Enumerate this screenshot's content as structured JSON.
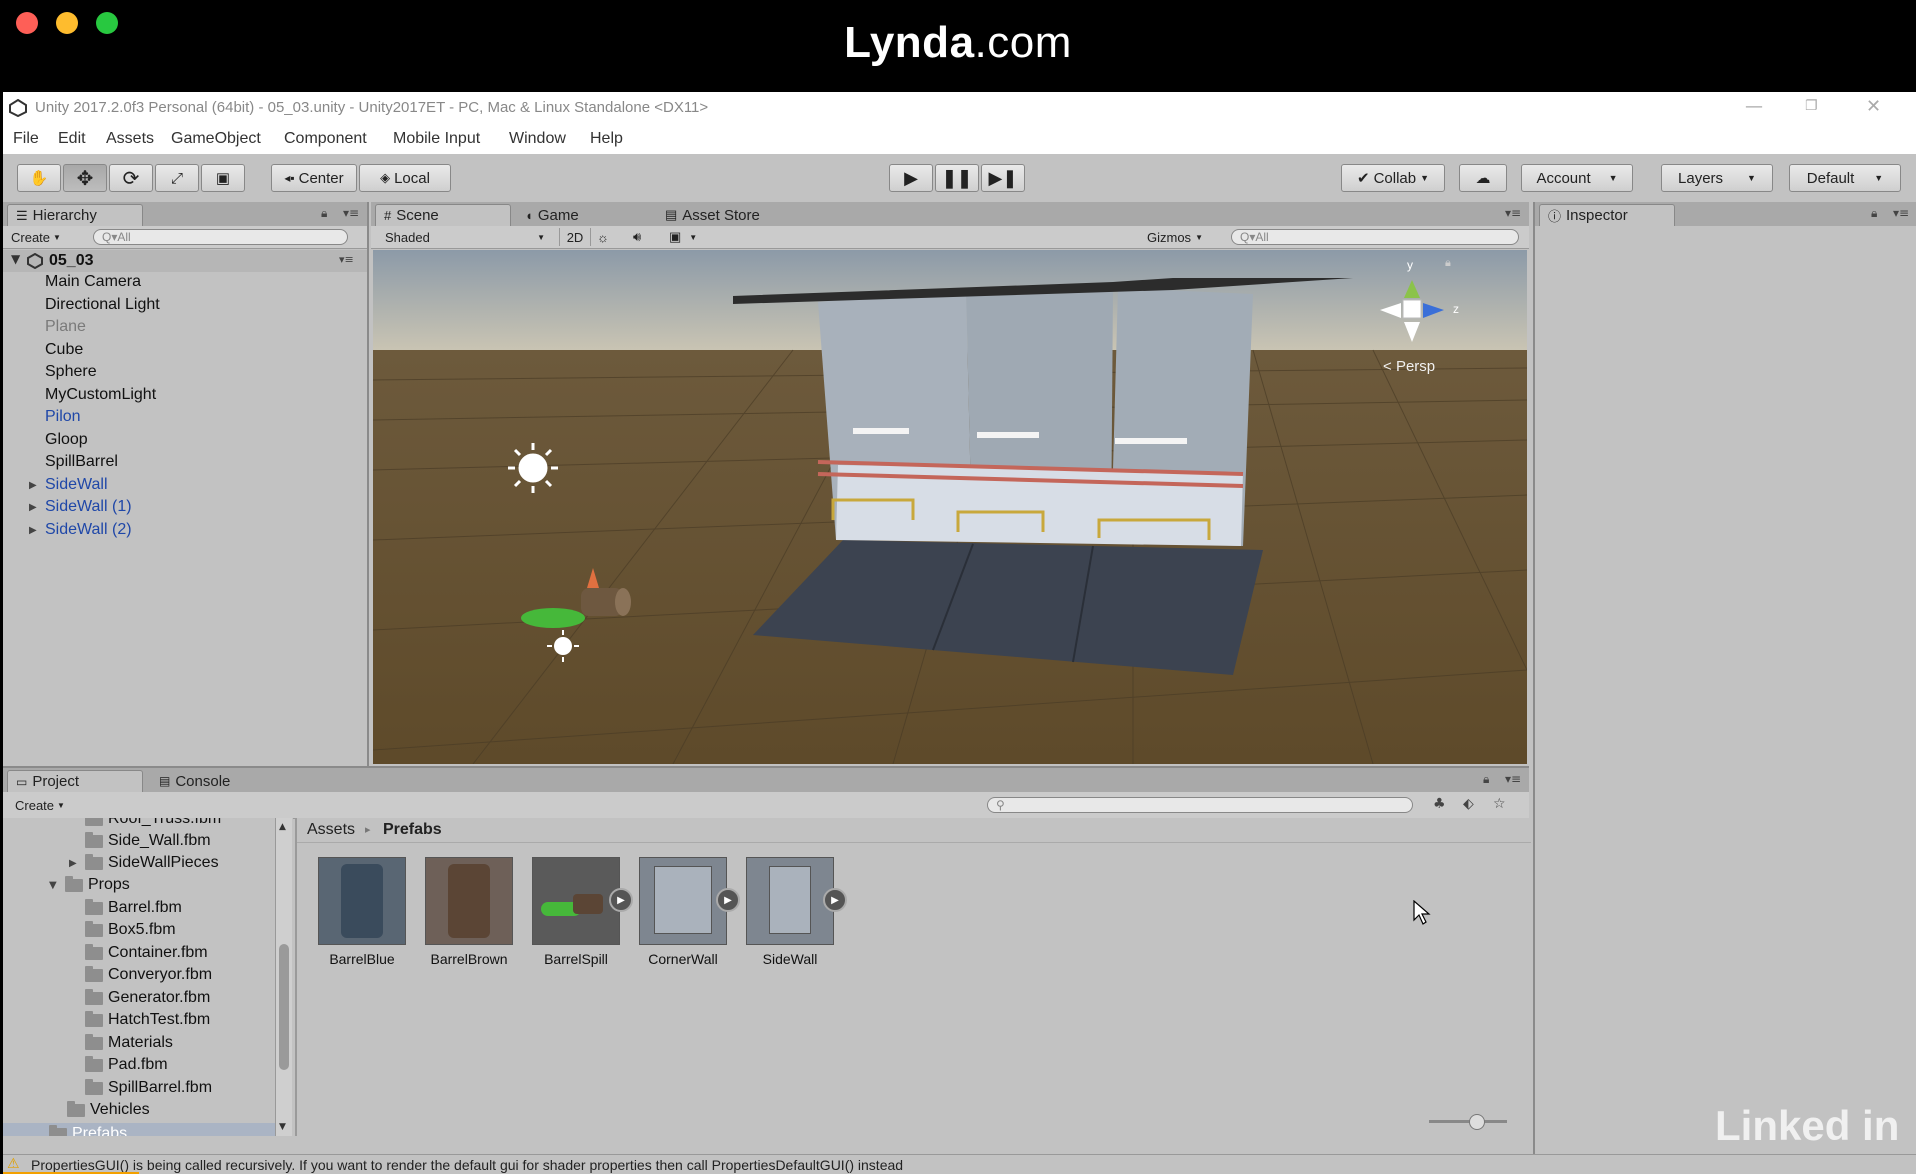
{
  "overlay": {
    "brand_bold": "Lynda",
    "brand_rest": ".com",
    "watermark": "Linked in"
  },
  "window": {
    "title": "Unity 2017.2.0f3 Personal (64bit) - 05_03.unity - Unity2017ET - PC, Mac & Linux Standalone <DX11>"
  },
  "menu": [
    "File",
    "Edit",
    "Assets",
    "GameObject",
    "Component",
    "Mobile Input",
    "Window",
    "Help"
  ],
  "toolbar": {
    "pivot": "Center",
    "space": "Local",
    "collab": "Collab",
    "account": "Account",
    "layers": "Layers",
    "layout": "Default"
  },
  "hierarchy": {
    "tab": "Hierarchy",
    "create": "Create",
    "search_placeholder": "Q▾All",
    "scene": "05_03",
    "items": [
      {
        "label": "Main Camera"
      },
      {
        "label": "Directional Light"
      },
      {
        "label": "Plane"
      },
      {
        "label": "Cube"
      },
      {
        "label": "Sphere"
      },
      {
        "label": "MyCustomLight"
      },
      {
        "label": "Pilon"
      },
      {
        "label": "Gloop"
      },
      {
        "label": "SpillBarrel"
      },
      {
        "label": "SideWall"
      },
      {
        "label": "SideWall (1)"
      },
      {
        "label": "SideWall (2)"
      }
    ]
  },
  "scene_view": {
    "tabs": {
      "scene": "Scene",
      "game": "Game",
      "asset_store": "Asset Store"
    },
    "shading": "Shaded",
    "mode_2d": "2D",
    "gizmos": "Gizmos",
    "search_placeholder": "Q▾All",
    "axis_y": "y",
    "axis_z": "z",
    "projection": "Persp"
  },
  "inspector": {
    "tab": "Inspector"
  },
  "project": {
    "tabs": {
      "project": "Project",
      "console": "Console"
    },
    "create": "Create",
    "breadcrumb": {
      "root": "Assets",
      "current": "Prefabs"
    },
    "tree": [
      {
        "label": "Roof_Truss.fbm"
      },
      {
        "label": "Side_Wall.fbm"
      },
      {
        "label": "SideWallPieces"
      },
      {
        "label": "Props"
      },
      {
        "label": "Barrel.fbm"
      },
      {
        "label": "Box5.fbm"
      },
      {
        "label": "Container.fbm"
      },
      {
        "label": "Converyor.fbm"
      },
      {
        "label": "Generator.fbm"
      },
      {
        "label": "HatchTest.fbm"
      },
      {
        "label": "Materials"
      },
      {
        "label": "Pad.fbm"
      },
      {
        "label": "SpillBarrel.fbm"
      },
      {
        "label": "Vehicles"
      },
      {
        "label": "Prefabs"
      }
    ],
    "assets": [
      {
        "label": "BarrelBlue"
      },
      {
        "label": "BarrelBrown"
      },
      {
        "label": "BarrelSpill"
      },
      {
        "label": "CornerWall"
      },
      {
        "label": "SideWall"
      }
    ]
  },
  "status": {
    "message": "PropertiesGUI() is being called recursively. If you want to render the default gui for shader properties then call PropertiesDefaultGUI() instead"
  }
}
